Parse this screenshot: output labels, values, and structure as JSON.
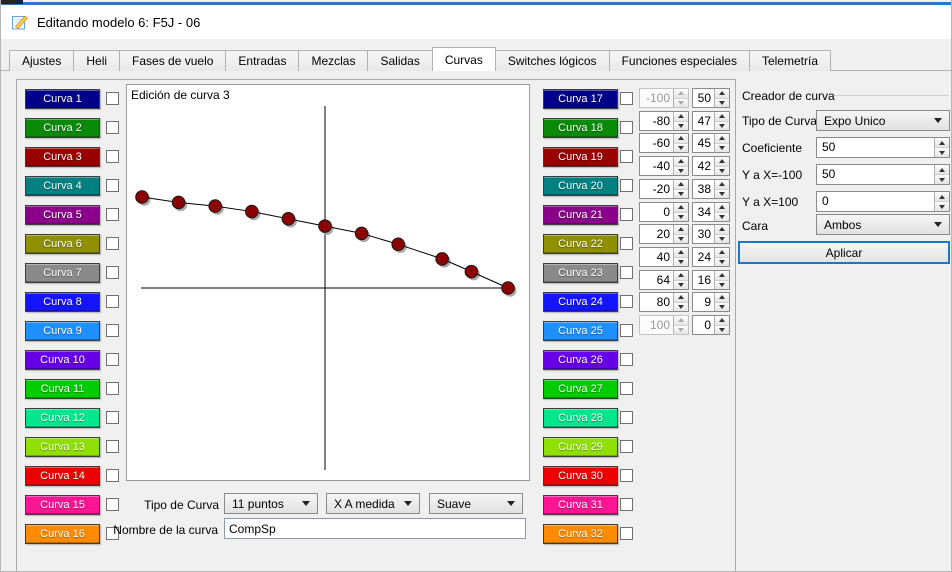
{
  "window": {
    "title": "Editando modelo 6: F5J - 06",
    "accent_color": "#2878c8"
  },
  "tab_bar": {
    "active": "Curvas",
    "tabs": [
      "Ajustes",
      "Heli",
      "Fases de vuelo",
      "Entradas",
      "Mezclas",
      "Salidas",
      "Curvas",
      "Switches lógicos",
      "Funciones especiales",
      "Telemetría"
    ]
  },
  "curve_buttons": {
    "left": [
      {
        "label": "Curva 1",
        "color": "#00008B"
      },
      {
        "label": "Curva 2",
        "color": "#088A08"
      },
      {
        "label": "Curva 3",
        "color": "#990000"
      },
      {
        "label": "Curva 4",
        "color": "#008080"
      },
      {
        "label": "Curva 5",
        "color": "#8B008B"
      },
      {
        "label": "Curva 6",
        "color": "#8F8F00"
      },
      {
        "label": "Curva 7",
        "color": "#8A8A8A"
      },
      {
        "label": "Curva 8",
        "color": "#1414FF"
      },
      {
        "label": "Curva 9",
        "color": "#1E90FF"
      },
      {
        "label": "Curva 10",
        "color": "#6600E6"
      },
      {
        "label": "Curva 11",
        "color": "#00CC00"
      },
      {
        "label": "Curva 12",
        "color": "#00E68C"
      },
      {
        "label": "Curva 13",
        "color": "#8FE000"
      },
      {
        "label": "Curva 14",
        "color": "#EE0000"
      },
      {
        "label": "Curva 15",
        "color": "#FF1493"
      },
      {
        "label": "Curva 16",
        "color": "#FF8C00"
      }
    ],
    "right": [
      {
        "label": "Curva 17",
        "color": "#00008B"
      },
      {
        "label": "Curva 18",
        "color": "#088A08"
      },
      {
        "label": "Curva 19",
        "color": "#990000"
      },
      {
        "label": "Curva 20",
        "color": "#008080"
      },
      {
        "label": "Curva 21",
        "color": "#8B008B"
      },
      {
        "label": "Curva 22",
        "color": "#8F8F00"
      },
      {
        "label": "Curva 23",
        "color": "#8A8A8A"
      },
      {
        "label": "Curva 24",
        "color": "#1414FF"
      },
      {
        "label": "Curva 25",
        "color": "#1E90FF"
      },
      {
        "label": "Curva 26",
        "color": "#6600E6"
      },
      {
        "label": "Curva 27",
        "color": "#00CC00"
      },
      {
        "label": "Curva 28",
        "color": "#00E68C"
      },
      {
        "label": "Curva 29",
        "color": "#8FE000"
      },
      {
        "label": "Curva 30",
        "color": "#EE0000"
      },
      {
        "label": "Curva 31",
        "color": "#FF1493"
      },
      {
        "label": "Curva 32",
        "color": "#FF8C00"
      }
    ]
  },
  "editor": {
    "title": "Edición de curva 3"
  },
  "chart_data": {
    "type": "line",
    "x": [
      -100,
      -80,
      -60,
      -40,
      -20,
      0,
      20,
      40,
      64,
      80,
      100
    ],
    "y": [
      50,
      47,
      45,
      42,
      38,
      34,
      30,
      24,
      16,
      9,
      0
    ],
    "xlim": [
      -100,
      100
    ],
    "ylim": [
      -100,
      100
    ],
    "point_color": "#8B0000",
    "line_color": "#000000",
    "axes": "cross",
    "title": "Edición de curva 3"
  },
  "point_spinners": [
    {
      "x": "-100",
      "y": "50",
      "x_disabled": true
    },
    {
      "x": "-80",
      "y": "47",
      "x_disabled": false
    },
    {
      "x": "-60",
      "y": "45",
      "x_disabled": false
    },
    {
      "x": "-40",
      "y": "42",
      "x_disabled": false
    },
    {
      "x": "-20",
      "y": "38",
      "x_disabled": false
    },
    {
      "x": "0",
      "y": "34",
      "x_disabled": false
    },
    {
      "x": "20",
      "y": "30",
      "x_disabled": false
    },
    {
      "x": "40",
      "y": "24",
      "x_disabled": false
    },
    {
      "x": "64",
      "y": "16",
      "x_disabled": false
    },
    {
      "x": "80",
      "y": "9",
      "x_disabled": false
    },
    {
      "x": "100",
      "y": "0",
      "x_disabled": true
    }
  ],
  "curve_settings": {
    "type_label": "Tipo de Curva",
    "points_combo": "11 puntos",
    "x_mode_combo": "X A medida",
    "smooth_combo": "Suave",
    "name_label": "Nombre de la curva",
    "name_value": "CompSp"
  },
  "creator": {
    "title": "Creador de curva",
    "type_label": "Tipo de Curva",
    "type_value": "Expo Unico",
    "coef_label": "Coeficiente",
    "coef_value": "50",
    "y_neg_label": "Y a X=-100",
    "y_neg_value": "50",
    "y_pos_label": "Y a X=100",
    "y_pos_value": "0",
    "side_label": "Cara",
    "side_value": "Ambos",
    "apply_label": "Aplicar"
  }
}
